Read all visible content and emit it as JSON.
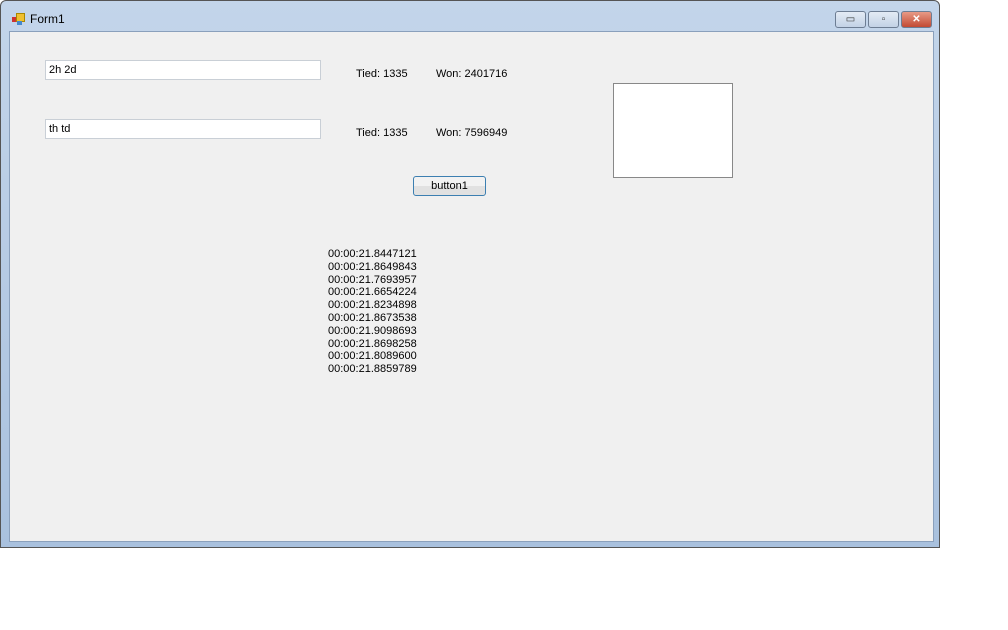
{
  "window": {
    "title": "Form1",
    "minimize": "▭",
    "maximize": "▫",
    "close": "✕"
  },
  "inputs": [
    {
      "value": "2h 2d"
    },
    {
      "value": "th td"
    }
  ],
  "results": [
    {
      "tied": "Tied: 1335",
      "won": "Won: 2401716"
    },
    {
      "tied": "Tied: 1335",
      "won": "Won: 7596949"
    }
  ],
  "button1": "button1",
  "times": [
    "00:00:21.8447121",
    "00:00:21.8649843",
    "00:00:21.7693957",
    "00:00:21.6654224",
    "00:00:21.8234898",
    "00:00:21.8673538",
    "00:00:21.9098693",
    "00:00:21.8698258",
    "00:00:21.8089600",
    "00:00:21.8859789"
  ]
}
